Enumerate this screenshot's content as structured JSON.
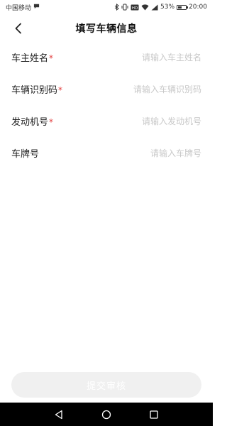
{
  "status_bar": {
    "carrier": "中国移动",
    "battery_percent": "53%",
    "battery_level": 0.53,
    "time": "20:00",
    "icons": [
      "message-icon",
      "bluetooth-icon",
      "vibrate-icon",
      "hd-icon",
      "wifi-icon",
      "signal-icon",
      "battery-icon"
    ]
  },
  "header": {
    "title": "填写车辆信息"
  },
  "form": {
    "fields": [
      {
        "label": "车主姓名",
        "required": true,
        "required_mark": "*",
        "placeholder": "请输入车主姓名",
        "value": ""
      },
      {
        "label": "车辆识别码",
        "required": true,
        "required_mark": "*",
        "placeholder": "请输入车辆识别码",
        "value": ""
      },
      {
        "label": "发动机号",
        "required": true,
        "required_mark": "*",
        "placeholder": "请输入发动机号",
        "value": ""
      },
      {
        "label": "车牌号",
        "required": false,
        "required_mark": "",
        "placeholder": "请输入车牌号",
        "value": ""
      }
    ]
  },
  "submit": {
    "label": "提交审核",
    "enabled": false
  },
  "colors": {
    "required": "#e23b3b",
    "placeholder": "#c8c8c8",
    "submit_disabled_bg": "#f0f0f0",
    "system_nav_bg": "#000000"
  }
}
